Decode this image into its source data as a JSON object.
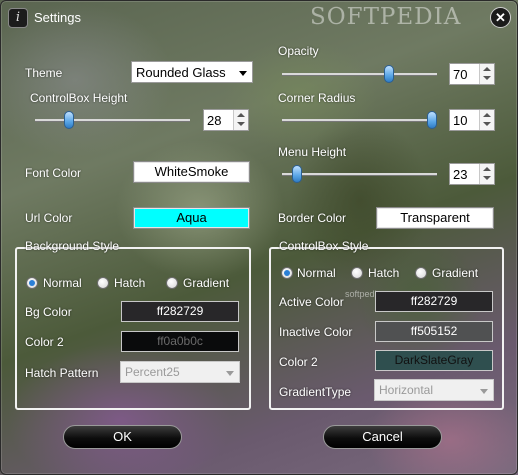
{
  "window": {
    "title": "Settings",
    "app_icon_glyph": "i",
    "watermark": "SOFTPEDIA",
    "watermark_small": "softpedia.com",
    "close_glyph": "✕"
  },
  "theme": {
    "label": "Theme",
    "value": "Rounded Glass"
  },
  "controlbox_height": {
    "label": "ControlBox Height",
    "value": "28",
    "slider_fraction": 0.2
  },
  "opacity": {
    "label": "Opacity",
    "value": "70",
    "slider_fraction": 0.7
  },
  "corner_radius": {
    "label": "Corner Radius",
    "value": "10",
    "slider_fraction": 1.0
  },
  "menu_height": {
    "label": "Menu Height",
    "value": "23",
    "slider_fraction": 0.07
  },
  "font_color": {
    "label": "Font Color",
    "value": "WhiteSmoke",
    "swatch": "#ffffff"
  },
  "url_color": {
    "label": "Url Color",
    "value": "Aqua",
    "swatch": "#00ffff"
  },
  "border_color": {
    "label": "Border Color",
    "value": "Transparent",
    "swatch": "#ffffff"
  },
  "background_style": {
    "title": "Background Style",
    "radios": [
      {
        "label": "Normal",
        "checked": true
      },
      {
        "label": "Hatch",
        "checked": false
      },
      {
        "label": "Gradient",
        "checked": false
      }
    ],
    "bg_color": {
      "label": "Bg Color",
      "value": "ff282729",
      "bg": "#282729",
      "fg": "#ffffff"
    },
    "color2": {
      "label": "Color 2",
      "value": "ff0a0b0c",
      "bg": "#0a0b0c",
      "fg": "#6a6a6a"
    },
    "hatch_pattern": {
      "label": "Hatch Pattern",
      "value": "Percent25"
    }
  },
  "controlbox_style": {
    "title": "ControlBox Style",
    "radios": [
      {
        "label": "Normal",
        "checked": true
      },
      {
        "label": "Hatch",
        "checked": false
      },
      {
        "label": "Gradient",
        "checked": false
      }
    ],
    "active_color": {
      "label": "Active Color",
      "value": "ff282729",
      "bg": "#282729",
      "fg": "#ffffff"
    },
    "inactive_color": {
      "label": "Inactive Color",
      "value": "ff505152",
      "bg": "#505152",
      "fg": "#ffffff"
    },
    "color2": {
      "label": "Color 2",
      "value": "DarkSlateGray",
      "bg": "#2f4f4f",
      "fg": "#111111"
    },
    "gradient_type": {
      "label": "GradientType",
      "value": "Horizontal"
    }
  },
  "buttons": {
    "ok": "OK",
    "cancel": "Cancel"
  }
}
